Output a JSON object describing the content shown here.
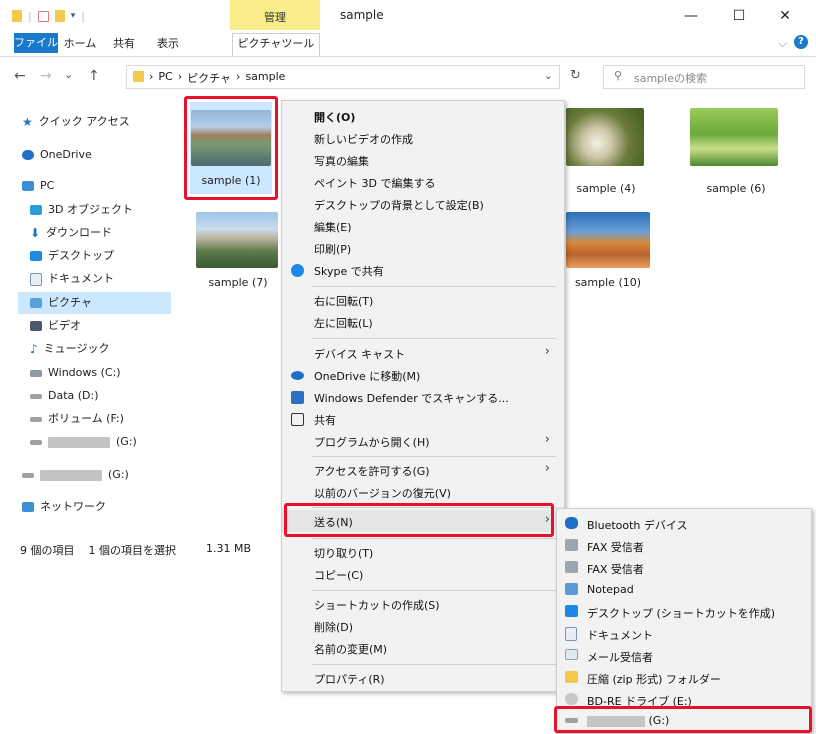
{
  "window": {
    "context_group": "管理",
    "title": "sample",
    "minimize": "—",
    "maximize": "☐",
    "close": "✕"
  },
  "ribbon": {
    "tabs": [
      "ファイル",
      "ホーム",
      "共有",
      "表示",
      "ピクチャツール"
    ],
    "expand": "⌵",
    "help": "?"
  },
  "address": {
    "back": "←",
    "forward": "→",
    "history": "⌄",
    "up": "↑",
    "path": [
      "PC",
      "ピクチャ",
      "sample"
    ],
    "sep": "›",
    "dropdown": "⌄",
    "refresh": "↻",
    "search_placeholder": "sampleの検索"
  },
  "nav": {
    "quick_access": "クイック アクセス",
    "onedrive": "OneDrive",
    "pc": "PC",
    "pc_items": [
      "3D オブジェクト",
      "ダウンロード",
      "デスクトップ",
      "ドキュメント",
      "ピクチャ",
      "ビデオ",
      "ミュージック",
      "Windows (C:)",
      "Data (D:)",
      "ボリューム (F:)"
    ],
    "removable_g1": "(G:)",
    "removable_g2": "(G:)",
    "network": "ネットワーク"
  },
  "files": [
    {
      "name": "sample (1)"
    },
    {
      "name": "sample (4)"
    },
    {
      "name": "sample (6)"
    },
    {
      "name": "sample (7)"
    },
    {
      "name": "sample (10)"
    }
  ],
  "status": {
    "count": "9 個の項目",
    "selected": "1 個の項目を選択",
    "size": "1.31 MB"
  },
  "context_menu": [
    {
      "label": "開く(O)",
      "bold": true
    },
    {
      "label": "新しいビデオの作成"
    },
    {
      "label": "写真の編集"
    },
    {
      "label": "ペイント 3D で編集する"
    },
    {
      "label": "デスクトップの背景として設定(B)"
    },
    {
      "label": "編集(E)"
    },
    {
      "label": "印刷(P)"
    },
    {
      "label": "Skype で共有",
      "icon": "skype-icon"
    },
    {
      "label": "右に回転(T)"
    },
    {
      "label": "左に回転(L)"
    },
    {
      "label": "デバイス キャスト",
      "submenu": true
    },
    {
      "label": "OneDrive に移動(M)",
      "icon": "onedrive-icon"
    },
    {
      "label": "Windows Defender でスキャンする...",
      "icon": "defender-icon"
    },
    {
      "label": "共有",
      "icon": "share-icon"
    },
    {
      "label": "プログラムから開く(H)",
      "submenu": true
    },
    {
      "label": "アクセスを許可する(G)",
      "submenu": true
    },
    {
      "label": "以前のバージョンの復元(V)"
    },
    {
      "label": "送る(N)",
      "submenu": true,
      "highlighted": true
    },
    {
      "label": "切り取り(T)"
    },
    {
      "label": "コピー(C)"
    },
    {
      "label": "ショートカットの作成(S)"
    },
    {
      "label": "削除(D)"
    },
    {
      "label": "名前の変更(M)"
    },
    {
      "label": "プロパティ(R)"
    }
  ],
  "sendto_menu": [
    {
      "label": "Bluetooth デバイス",
      "icon": "bluetooth-icon"
    },
    {
      "label": "FAX 受信者",
      "icon": "fax-icon"
    },
    {
      "label": "FAX 受信者",
      "icon": "fax-icon"
    },
    {
      "label": "Notepad",
      "icon": "notepad-icon"
    },
    {
      "label": "デスクトップ (ショートカットを作成)",
      "icon": "desktop-icon"
    },
    {
      "label": "ドキュメント",
      "icon": "documents-icon"
    },
    {
      "label": "メール受信者",
      "icon": "mail-icon"
    },
    {
      "label": "圧縮 (zip 形式) フォルダー",
      "icon": "zip-folder-icon"
    },
    {
      "label": "BD-RE ドライブ (E:)",
      "icon": "optical-drive-icon"
    },
    {
      "label": "(G:)",
      "icon": "removable-drive-icon",
      "highlighted": true
    }
  ],
  "colors": {
    "accent": "#1979ca",
    "highlight_box": "#e8102a",
    "context_tab": "#f9ec8a",
    "nav_selected": "#cce8ff",
    "menu_bg": "#f2f2f2"
  }
}
